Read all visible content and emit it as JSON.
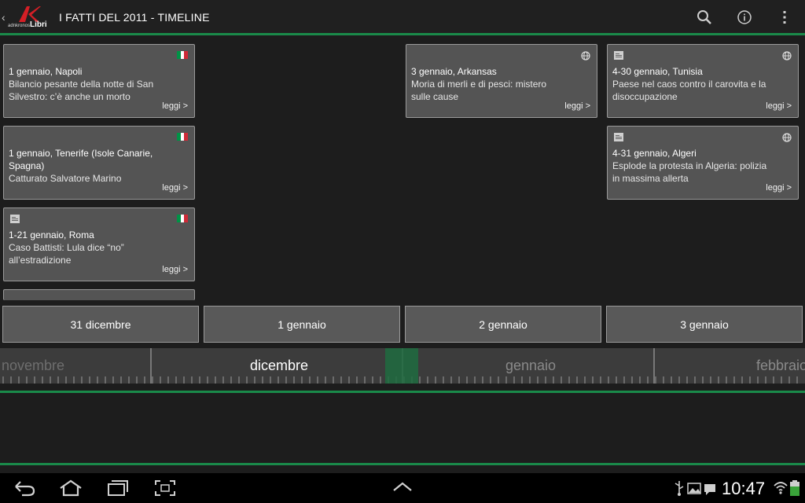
{
  "app": {
    "title": "I FATTI DEL 2011 - TIMELINE",
    "logo": {
      "small": "adnkronos",
      "big": "Libri"
    }
  },
  "actionbar": {
    "icons": [
      "search-icon",
      "info-icon",
      "overflow-menu-icon"
    ]
  },
  "cards": [
    {
      "place": "1 gennaio, Napoli",
      "desc": [
        "Bilancio pesante della notte di San",
        "Silvestro: c’è anche un morto"
      ],
      "link": "leggi >",
      "badge": "flag-italy",
      "doc": false
    },
    {
      "place": "1 gennaio, Tenerife (Isole Canarie,",
      "place2": "Spagna)",
      "desc": [
        "Catturato Salvatore Marino"
      ],
      "link": "leggi >",
      "badge": "flag-italy",
      "doc": false
    },
    {
      "place": "1-21 gennaio, Roma",
      "desc": [
        "Caso Battisti: Lula dice “no”",
        "all’estradizione"
      ],
      "link": "leggi >",
      "badge": "flag-italy",
      "doc": true
    },
    {
      "place": "3 gennaio, Arkansas",
      "desc": [
        "Moria di merli e di pesci: mistero",
        "sulle cause"
      ],
      "link": "leggi >",
      "badge": "globe",
      "doc": false
    },
    {
      "place": "4-30 gennaio, Tunisia",
      "desc": [
        "Paese nel caos contro il carovita e la",
        "disoccupazione"
      ],
      "link": "leggi >",
      "badge": "globe",
      "doc": true
    },
    {
      "place": "4-31 gennaio, Algeri",
      "desc": [
        "Esplode la protesta in Algeria: polizia",
        "in massima allerta"
      ],
      "link": "leggi >",
      "badge": "globe",
      "doc": true
    }
  ],
  "date_tabs": [
    "31 dicembre",
    "1 gennaio",
    "2 gennaio",
    "3 gennaio"
  ],
  "ruler": {
    "months": [
      "novembre",
      "dicembre",
      "gennaio",
      "febbraio"
    ],
    "active_month": "dicembre"
  },
  "colors": {
    "accent": "#1a8a4a",
    "card_bg": "#545454",
    "flag_green": "#009246",
    "flag_white": "#ffffff",
    "flag_red": "#ce2b37"
  },
  "statusbar": {
    "time": "10:47"
  }
}
